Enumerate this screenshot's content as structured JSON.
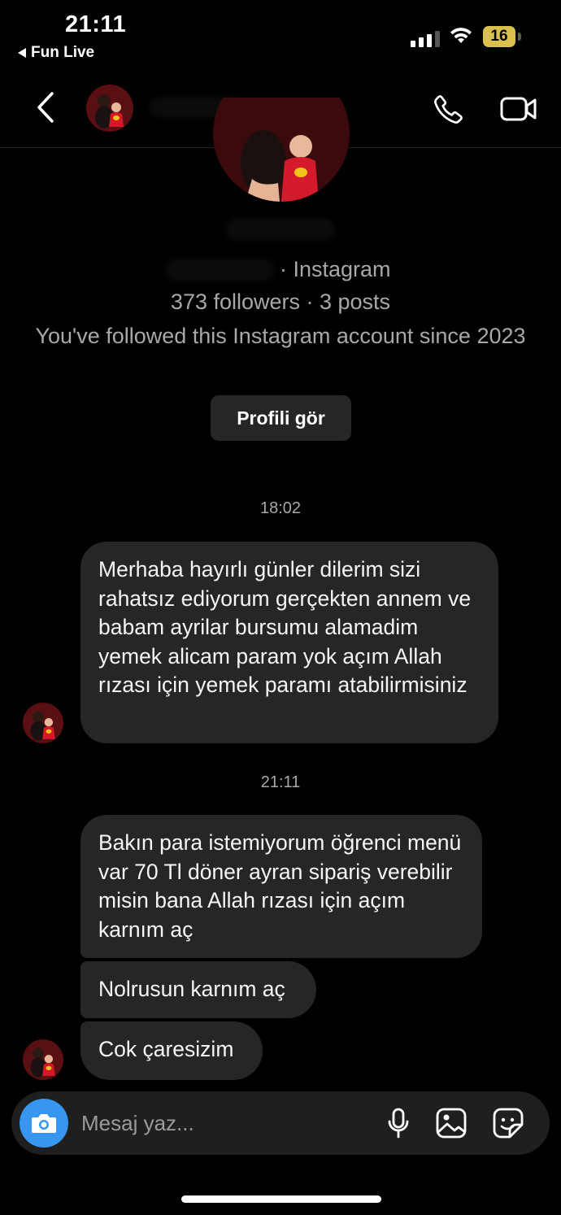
{
  "status_bar": {
    "time": "21:11",
    "back_app": "Fun Live",
    "battery": "16"
  },
  "header": {
    "back_icon": "chevron-left-icon",
    "call_icon": "phone-icon",
    "video_icon": "video-camera-icon"
  },
  "profile": {
    "platform": "· Instagram",
    "stats": "373 followers · 3 posts",
    "follow_since": "You've followed this Instagram account since 2023",
    "view_profile_label": "Profili gör"
  },
  "messages": {
    "timestamp_1": "18:02",
    "msg_1": "Merhaba hayırlı günler dilerim sizi rahatsız ediyorum gerçekten annem ve babam ayrilar bursumu alamadim yemek alicam param yok açım Allah rızası için yemek paramı atabilirmisiniz",
    "timestamp_2": "21:11",
    "msg_2": "Bakın para istemiyorum öğrenci menü var 70 Tl döner ayran sipariş verebilir misin bana Allah rızası için açım karnım aç",
    "msg_3": "Nolrusun karnım aç",
    "msg_4": "Cok çaresizim"
  },
  "composer": {
    "placeholder": "Mesaj yaz...",
    "camera_color": "#3797f0"
  },
  "colors": {
    "background": "#000000",
    "bubble": "#262626",
    "muted_text": "#a8a8a8"
  }
}
